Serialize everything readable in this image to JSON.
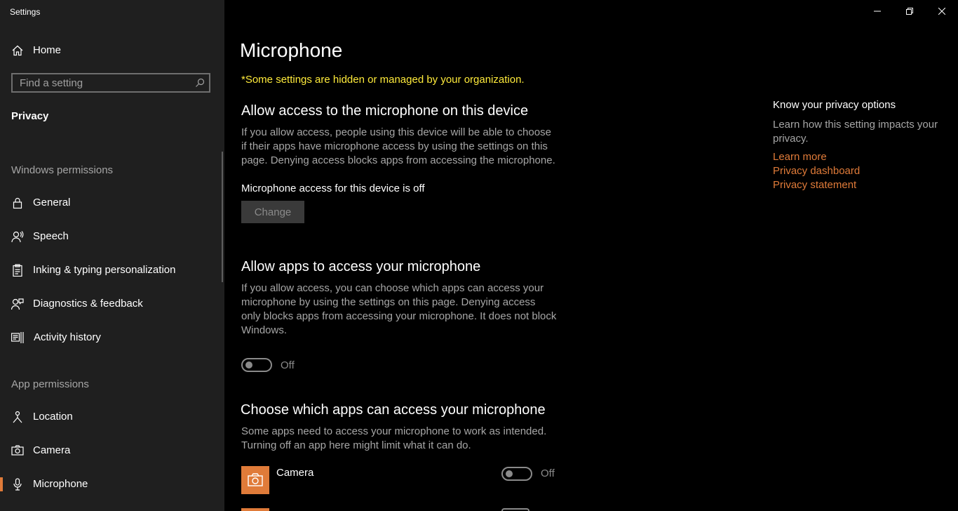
{
  "window": {
    "title": "Settings"
  },
  "sidebar": {
    "home": "Home",
    "search_placeholder": "Find a setting",
    "privacy": "Privacy",
    "windows_permissions": "Windows permissions",
    "items_windows": [
      {
        "label": "General",
        "icon": "lock-icon"
      },
      {
        "label": "Speech",
        "icon": "speech-icon"
      },
      {
        "label": "Inking & typing personalization",
        "icon": "clipboard-icon"
      },
      {
        "label": "Diagnostics & feedback",
        "icon": "person-feedback-icon"
      },
      {
        "label": "Activity history",
        "icon": "activity-icon"
      }
    ],
    "app_permissions": "App permissions",
    "items_app": [
      {
        "label": "Location",
        "icon": "location-icon"
      },
      {
        "label": "Camera",
        "icon": "camera-icon"
      },
      {
        "label": "Microphone",
        "icon": "microphone-icon",
        "selected": true
      }
    ]
  },
  "main": {
    "title": "Microphone",
    "notice": "*Some settings are hidden or managed by your organization.",
    "device_section": {
      "heading": "Allow access to the microphone on this device",
      "description": "If you allow access, people using this device will be able to choose if their apps have microphone access by using the settings on this page. Denying access blocks apps from accessing the microphone.",
      "status": "Microphone access for this device is off",
      "button": "Change"
    },
    "apps_section": {
      "heading": "Allow apps to access your microphone",
      "description": "If you allow access, you can choose which apps can access your microphone by using the settings on this page. Denying access only blocks apps from accessing your microphone. It does not block Windows.",
      "toggle_label": "Off"
    },
    "choose_section": {
      "heading": "Choose which apps can access your microphone",
      "description": "Some apps need to access your microphone to work as intended. Turning off an app here might limit what it can do.",
      "apps": [
        {
          "name": "Camera",
          "toggle_label": "Off",
          "icon": "camera-app-icon"
        }
      ]
    }
  },
  "info_panel": {
    "title": "Know your privacy options",
    "description": "Learn how this setting impacts your privacy.",
    "links": [
      "Learn more",
      "Privacy dashboard",
      "Privacy statement"
    ]
  },
  "colors": {
    "accent": "#e07b39",
    "notice": "#ffeb3b",
    "sidebar_bg": "#1f1f1f",
    "background": "#000000"
  }
}
